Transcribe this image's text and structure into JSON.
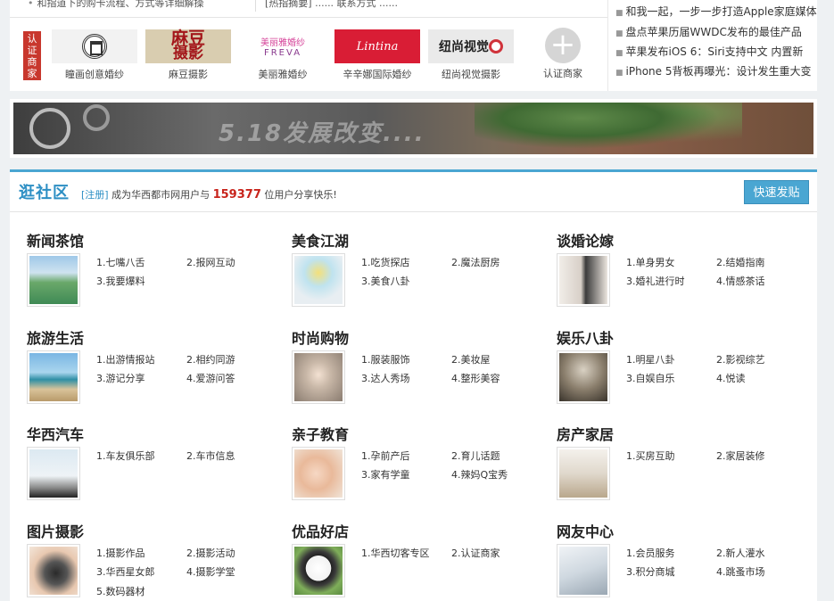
{
  "top_strip": {
    "fragment_left": "和指道下的购卡流程、方式等详细解操",
    "fragment_right": "[热指摘要]  ......  联系方式 ......",
    "cert_tag": "认证商家",
    "merchants": [
      {
        "logo_text": "",
        "name": "瞳画创意婚纱"
      },
      {
        "logo_text": "麻豆",
        "logo_text2": "摄影",
        "name": "麻豆摄影"
      },
      {
        "logo_text": "美丽雅婚纱",
        "logo_text2": "FREVA",
        "name": "美丽雅婚纱"
      },
      {
        "logo_text": "Lintina",
        "name": "辛辛娜国际婚纱"
      },
      {
        "logo_text": "纽尚视觉",
        "name": "纽尚视觉摄影"
      }
    ],
    "add_merchant": {
      "icon": "plus-icon",
      "label": "认证商家"
    },
    "news": [
      "和我一起，一步一步打造Apple家庭媒体",
      "盘点苹果历届WWDC发布的最佳产品",
      "苹果发布iOS 6：Siri支持中文 内置新",
      "iPhone 5背板再曝光：设计发生重大变"
    ]
  },
  "banner": {
    "text": "5.18发展改变...."
  },
  "community": {
    "title": "逛社区",
    "register_link": "[注册]",
    "subtitle_pre": "成为华西都市网用户与",
    "user_count": "159377",
    "subtitle_post": "位用户分享快乐!",
    "quick_post_label": "快速发贴",
    "accent_color": "#4aa6d2",
    "sections": [
      {
        "title": "新闻茶馆",
        "image": "resort-image",
        "links": [
          "1.七嘴八舌",
          "2.报网互动",
          "3.我要爆料"
        ]
      },
      {
        "title": "美食江湖",
        "image": "cocktail-image",
        "links": [
          "1.吃货探店",
          "2.魔法厨房",
          "3.美食八卦"
        ]
      },
      {
        "title": "谈婚论嫁",
        "image": "wedding-image",
        "links": [
          "1.单身男女",
          "2.结婚指南",
          "3.婚礼进行时",
          "4.情感茶话"
        ]
      },
      {
        "title": "旅游生活",
        "image": "beach-image",
        "links": [
          "1.出游情报站",
          "2.相约同游",
          "3.游记分享",
          "4.爱游问答"
        ]
      },
      {
        "title": "时尚购物",
        "image": "fashion-image",
        "links": [
          "1.服装服饰",
          "2.美妆屋",
          "3.达人秀场",
          "4.整形美容"
        ]
      },
      {
        "title": "娱乐八卦",
        "image": "microphone-image",
        "links": [
          "1.明星八卦",
          "2.影视综艺",
          "3.自娱自乐",
          "4.悦读"
        ]
      },
      {
        "title": "华西汽车",
        "image": "lighthouse-car-image",
        "links": [
          "1.车友俱乐部",
          "2.车市信息"
        ]
      },
      {
        "title": "亲子教育",
        "image": "baby-image",
        "links": [
          "1.孕前产后",
          "2.育儿话题",
          "3.家有学童",
          "4.辣妈Q宝秀"
        ]
      },
      {
        "title": "房产家居",
        "image": "room-image",
        "links": [
          "1.买房互助",
          "2.家居装修"
        ]
      },
      {
        "title": "图片摄影",
        "image": "camera-image",
        "links": [
          "1.摄影作品",
          "2.摄影活动",
          "3.华西星女郎",
          "4.摄影学堂",
          "5.数码器材"
        ]
      },
      {
        "title": "优品好店",
        "image": "panda-image",
        "links": [
          "1.华西切客专区",
          "2.认证商家"
        ]
      },
      {
        "title": "网友中心",
        "image": "keyboard-image",
        "links": [
          "1.会员服务",
          "2.新人灌水",
          "3.积分商城",
          "4.跳蚤市场"
        ]
      }
    ]
  }
}
